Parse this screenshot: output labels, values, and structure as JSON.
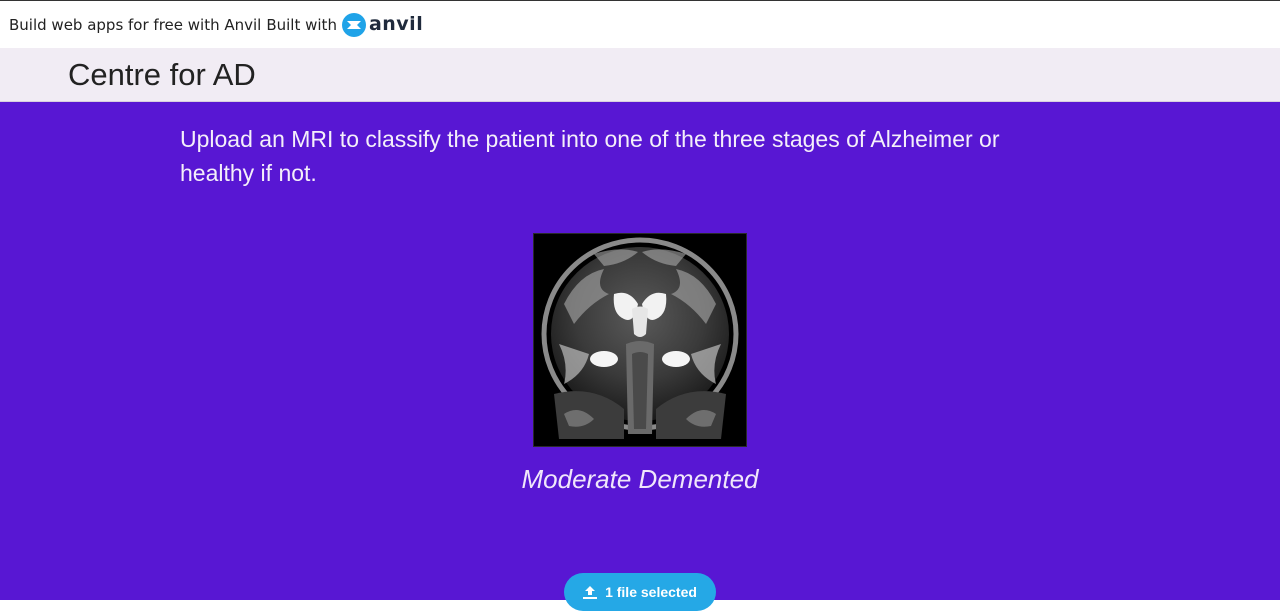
{
  "banner": {
    "text": "Build web apps for free with Anvil",
    "built_with": "Built with",
    "logo_text": "anvil"
  },
  "header": {
    "title": "Centre for AD"
  },
  "main": {
    "description": "Upload an MRI to classify the patient into one of the three stages of Alzheimer or healthy if not.",
    "result": "Moderate Demented",
    "upload_button": {
      "label": "1 file selected",
      "icon": "upload-icon"
    }
  },
  "colors": {
    "main_background": "#5817d3",
    "header_background": "#f1ecf4",
    "button_background": "#25a8e6",
    "anvil_brand": "#1fa3e8"
  }
}
